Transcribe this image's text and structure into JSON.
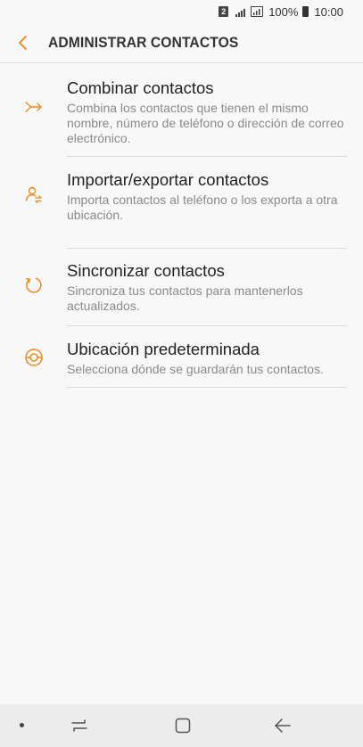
{
  "status_bar": {
    "sim_number": "2",
    "battery": "100%",
    "time": "10:00"
  },
  "header": {
    "title": "ADMINISTRAR CONTACTOS"
  },
  "items": [
    {
      "title": "Combinar contactos",
      "description": "Combina los contactos que tienen el mismo nombre, número de teléfono o dirección de correo electrónico.",
      "icon": "merge-icon"
    },
    {
      "title": "Importar/exportar contactos",
      "description": "Importa contactos al teléfono o los exporta a otra ubicación.",
      "icon": "import-export-icon"
    },
    {
      "title": "Sincronizar contactos",
      "description": "Sincroniza tus contactos para mantenerlos actualizados.",
      "icon": "sync-icon"
    },
    {
      "title": "Ubicación predeterminada",
      "description": "Selecciona dónde se guardarán tus contactos.",
      "icon": "storage-location-icon"
    }
  ],
  "colors": {
    "accent": "#f0891b",
    "background": "#f8f8f8",
    "nav_bar": "#ececec"
  }
}
